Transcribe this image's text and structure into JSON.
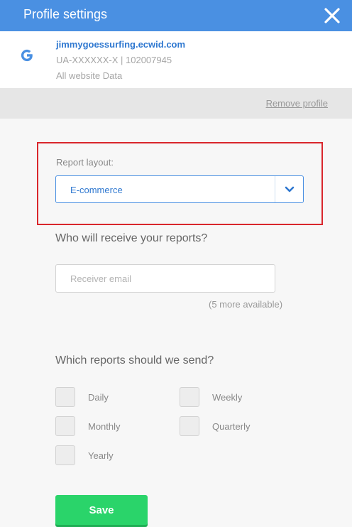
{
  "colors": {
    "header": "#4a90e2",
    "accent": "#2f78d0",
    "highlight": "#d9262c",
    "save": "#2ad46a"
  },
  "header": {
    "title": "Profile settings",
    "close_icon": "close-icon"
  },
  "profile": {
    "icon": "google-g-icon",
    "site": "jimmygoessurfing.ecwid.com",
    "account": "UA-XXXXXX-X | 102007945",
    "view": "All website Data"
  },
  "remove_profile": "Remove profile",
  "report_layout": {
    "label": "Report layout:",
    "selected": "E-commerce",
    "dropdown_icon": "chevron-down-icon"
  },
  "recipients": {
    "title": "Who will receive your reports?",
    "placeholder": "Receiver email",
    "value": "",
    "more_available": "(5 more available)"
  },
  "reports": {
    "title": "Which reports should we send?",
    "options": [
      {
        "label": "Daily",
        "checked": false
      },
      {
        "label": "Weekly",
        "checked": false
      },
      {
        "label": "Monthly",
        "checked": false
      },
      {
        "label": "Quarterly",
        "checked": false
      },
      {
        "label": "Yearly",
        "checked": false
      }
    ]
  },
  "save_label": "Save"
}
